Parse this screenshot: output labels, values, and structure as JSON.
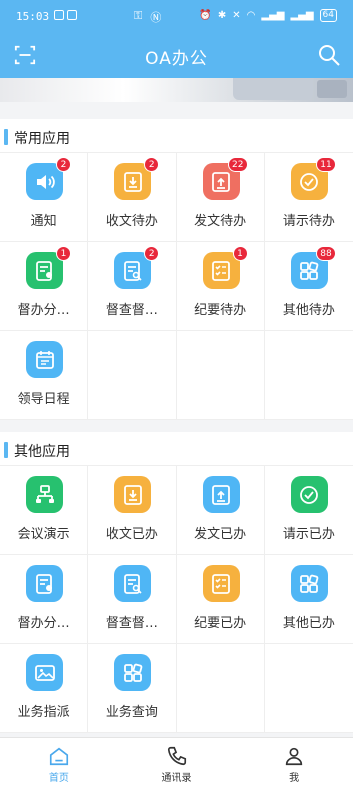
{
  "status_bar": {
    "time": "15:03",
    "battery": "64"
  },
  "header": {
    "title": "OA办公"
  },
  "sections": [
    {
      "title": "常用应用",
      "items": [
        {
          "label": "通知",
          "badge": "2",
          "icon": "speaker-icon",
          "color": "#4fb6f5"
        },
        {
          "label": "收文待办",
          "badge": "2",
          "icon": "inbox-download-icon",
          "color": "#f6b13e"
        },
        {
          "label": "发文待办",
          "badge": "22",
          "icon": "outbox-upload-icon",
          "color": "#ef6f61"
        },
        {
          "label": "请示待办",
          "badge": "11",
          "icon": "approval-check-icon",
          "color": "#f6b13e"
        },
        {
          "label": "督办分…",
          "badge": "1",
          "icon": "supervise-doc-icon",
          "color": "#27c16f"
        },
        {
          "label": "督查督…",
          "badge": "2",
          "icon": "inspect-doc-icon",
          "color": "#4fb6f5"
        },
        {
          "label": "纪要待办",
          "badge": "1",
          "icon": "checklist-icon",
          "color": "#f6b13e"
        },
        {
          "label": "其他待办",
          "badge": "88",
          "icon": "apps-grid-icon",
          "color": "#4fb6f5"
        },
        {
          "label": "领导日程",
          "badge": "",
          "icon": "calendar-icon",
          "color": "#4fb6f5"
        }
      ]
    },
    {
      "title": "其他应用",
      "items": [
        {
          "label": "会议演示",
          "badge": "",
          "icon": "presentation-icon",
          "color": "#27c16f"
        },
        {
          "label": "收文已办",
          "badge": "",
          "icon": "inbox-download-icon",
          "color": "#f6b13e"
        },
        {
          "label": "发文已办",
          "badge": "",
          "icon": "outbox-upload-icon",
          "color": "#4fb6f5"
        },
        {
          "label": "请示已办",
          "badge": "",
          "icon": "approval-check-icon",
          "color": "#27c16f"
        },
        {
          "label": "督办分…",
          "badge": "",
          "icon": "supervise-doc-icon",
          "color": "#4fb6f5"
        },
        {
          "label": "督查督…",
          "badge": "",
          "icon": "inspect-doc-icon",
          "color": "#4fb6f5"
        },
        {
          "label": "纪要已办",
          "badge": "",
          "icon": "checklist-icon",
          "color": "#f6b13e"
        },
        {
          "label": "其他已办",
          "badge": "",
          "icon": "apps-grid-icon",
          "color": "#4fb6f5"
        },
        {
          "label": "业务指派",
          "badge": "",
          "icon": "picture-icon",
          "color": "#4fb6f5"
        },
        {
          "label": "业务查询",
          "badge": "",
          "icon": "apps-grid-icon",
          "color": "#4fb6f5"
        }
      ]
    }
  ],
  "tabbar": {
    "tabs": [
      {
        "label": "首页",
        "icon": "home-icon",
        "active": true
      },
      {
        "label": "通讯录",
        "icon": "phone-icon",
        "active": false
      },
      {
        "label": "我",
        "icon": "user-icon",
        "active": false
      }
    ]
  }
}
